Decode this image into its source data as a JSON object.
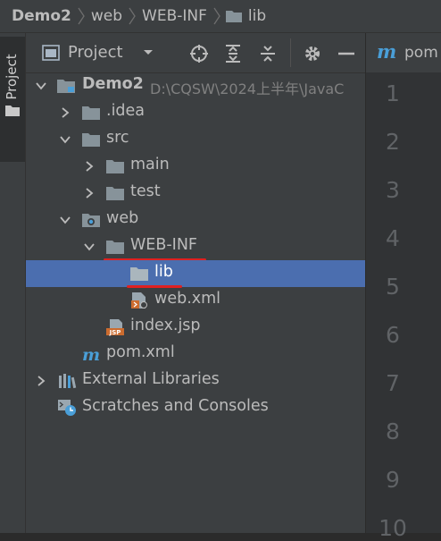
{
  "breadcrumb": [
    "Demo2",
    "web",
    "WEB-INF",
    "lib"
  ],
  "side_tab": {
    "label": "Project"
  },
  "panel": {
    "title": "Project",
    "buttons": [
      "locate-icon",
      "expand-all-icon",
      "collapse-all-icon",
      "gear-icon",
      "minimize-icon"
    ]
  },
  "tree": [
    {
      "label": "Demo2",
      "path": "D:\\CQSW\\2024上半年\\JavaC",
      "indent": 0,
      "arrow": "down",
      "icon": "module-folder",
      "bold": true
    },
    {
      "label": ".idea",
      "indent": 1,
      "arrow": "right",
      "icon": "folder"
    },
    {
      "label": "src",
      "indent": 1,
      "arrow": "down",
      "icon": "folder"
    },
    {
      "label": "main",
      "indent": 2,
      "arrow": "right",
      "icon": "folder"
    },
    {
      "label": "test",
      "indent": 2,
      "arrow": "right",
      "icon": "folder"
    },
    {
      "label": "web",
      "indent": 1,
      "arrow": "down",
      "icon": "web-folder"
    },
    {
      "label": "WEB-INF",
      "indent": 2,
      "arrow": "down",
      "icon": "folder"
    },
    {
      "label": "lib",
      "indent": 3,
      "arrow": "none",
      "icon": "folder",
      "selected": true
    },
    {
      "label": "web.xml",
      "indent": 3,
      "arrow": "none",
      "icon": "xml-file"
    },
    {
      "label": "index.jsp",
      "indent": 2,
      "arrow": "none",
      "icon": "jsp-file"
    },
    {
      "label": "pom.xml",
      "indent": 1,
      "arrow": "none",
      "icon": "maven-file"
    },
    {
      "label": "External Libraries",
      "indent": 0,
      "arrow": "right",
      "icon": "libraries"
    },
    {
      "label": "Scratches and Consoles",
      "indent": 0,
      "arrow": "none",
      "icon": "scratches"
    }
  ],
  "editor": {
    "tab_icon": "m",
    "tab_name": "pom",
    "line_numbers": [
      "1",
      "2",
      "3",
      "4",
      "5",
      "6",
      "7",
      "8",
      "9",
      "10"
    ]
  },
  "colors": {
    "background": "#2b2b2b",
    "panel": "#3c3f41",
    "selection": "#4b6eaf",
    "annotation": "#e02020",
    "folder": "#87939a"
  }
}
